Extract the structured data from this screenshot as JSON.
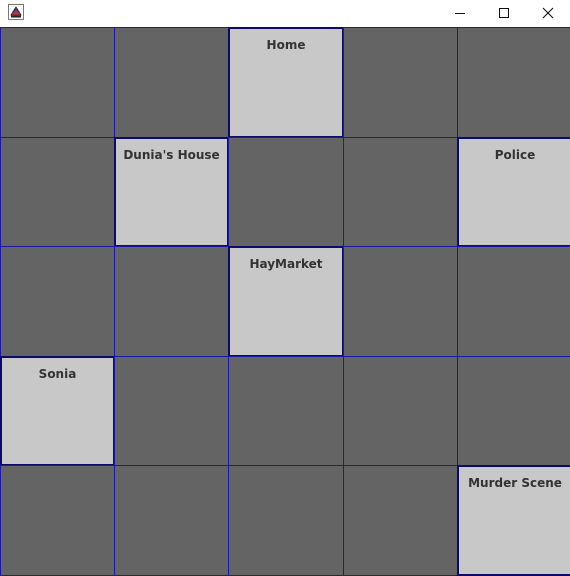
{
  "window": {
    "icon": "java-app-icon",
    "controls": [
      "minimize-icon",
      "maximize-icon",
      "close-icon"
    ]
  },
  "colors": {
    "empty_cell": "#646464",
    "location_cell": "#c8c8c8",
    "grid_line": "#1a1aa6",
    "label_text": "#333333"
  },
  "board": {
    "rows": [
      [
        "",
        "",
        "Home",
        "",
        ""
      ],
      [
        "",
        "Dunia's House",
        "",
        "",
        "Police"
      ],
      [
        "",
        "",
        "HayMarket",
        "",
        ""
      ],
      [
        "Sonia",
        "",
        "",
        "",
        ""
      ],
      [
        "",
        "",
        "",
        "",
        "Murder Scene"
      ]
    ]
  }
}
